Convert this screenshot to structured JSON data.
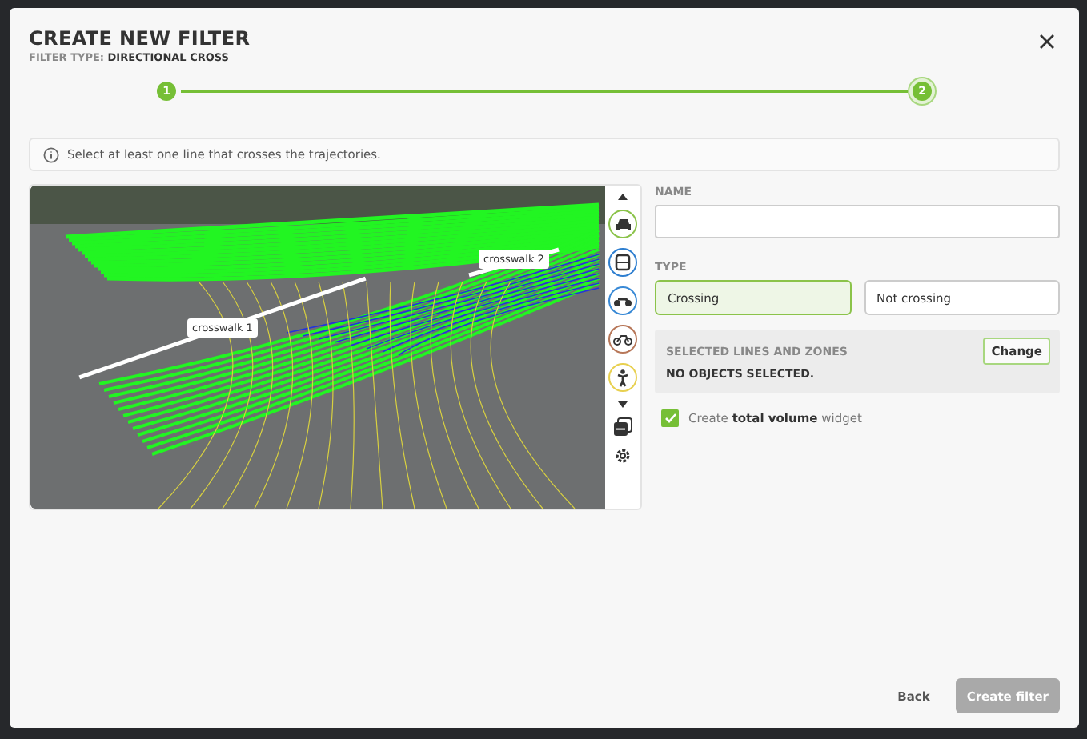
{
  "dialog": {
    "title": "CREATE NEW FILTER",
    "subtitle": "FILTER TYPE: **DIRECTIONAL CROSS**"
  },
  "steps": [
    {
      "label": "1",
      "selected": false
    },
    {
      "label": "2",
      "selected": true
    }
  ],
  "info": "Select at least one line that crosses the trajectories.",
  "video": {
    "lines": [
      {
        "label": "crosswalk 1"
      },
      {
        "label": "crosswalk 2"
      }
    ]
  },
  "class_filters": [
    {
      "kind": "car",
      "color": "#8bc34a"
    },
    {
      "kind": "bus",
      "color": "#2f7fd0"
    },
    {
      "kind": "motorbike",
      "color": "#3a8ad6"
    },
    {
      "kind": "bicycle",
      "color": "#b8785a"
    },
    {
      "kind": "pedestrian",
      "color": "#e8d050"
    }
  ],
  "form": {
    "name_label": "NAME",
    "type_label": "TYPE",
    "types": [
      {
        "label": "Crossing",
        "selected": true
      },
      {
        "label": "Not crossing",
        "selected": false
      }
    ],
    "selection": {
      "title": "SELECTED LINES AND ZONES",
      "button": "Change",
      "empty": "NO OBJECTS SELECTED."
    },
    "widget": {
      "label": "Create **total volume** widget",
      "checked": true
    }
  },
  "footer": {
    "back": "Back",
    "create": {
      "label": "Create filter",
      "disabled": true
    }
  }
}
